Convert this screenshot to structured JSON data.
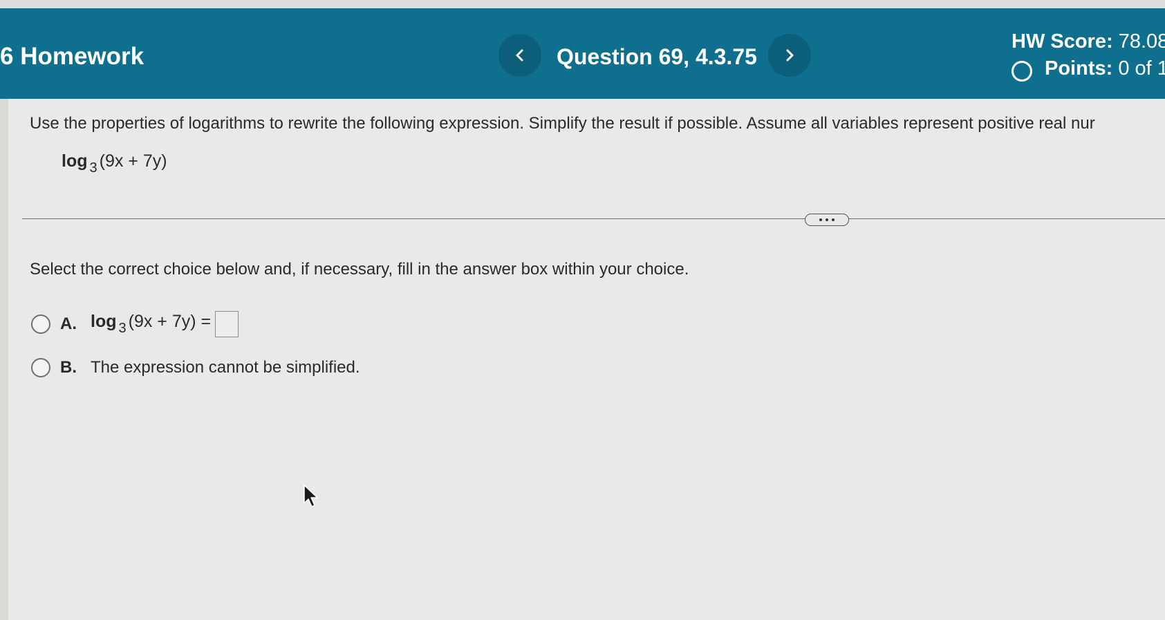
{
  "header": {
    "title": "6 Homework",
    "question_title": "Question 69, 4.3.75",
    "prev_icon": "chevron-left-icon",
    "next_icon": "chevron-right-icon",
    "hw_score_label": "HW Score:",
    "hw_score_value": "78.08",
    "points_label": "Points:",
    "points_value": "0 of 1"
  },
  "question": {
    "instructions": "Use the properties of logarithms to rewrite the following expression. Simplify the result if possible. Assume all variables represent positive real nur",
    "expression_fn": "log",
    "expression_base": "3",
    "expression_arg": "(9x + 7y)",
    "more_icon": "ellipsis-icon",
    "select_instruction": "Select the correct choice below and, if necessary, fill in the answer box within your choice."
  },
  "choices": [
    {
      "letter": "A.",
      "fn": "log",
      "base": "3",
      "arg": "(9x + 7y) =",
      "answer_value": ""
    },
    {
      "letter": "B.",
      "text": "The expression cannot be simplified."
    }
  ],
  "colors": {
    "header_bg": "#0e6f8e",
    "nav_button_bg": "#0b5f7b",
    "page_bg": "#e9e9e7"
  }
}
